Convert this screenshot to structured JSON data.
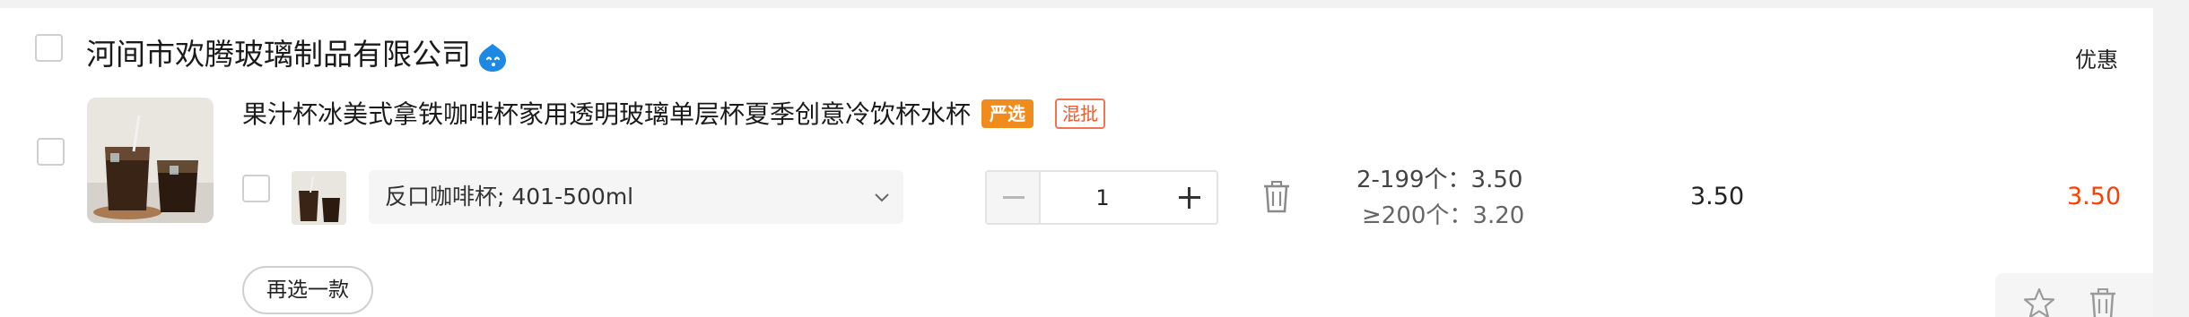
{
  "shop": {
    "name": "河间市欢腾玻璃制品有限公司",
    "icons": {
      "chat": "wangwang-chat-icon"
    }
  },
  "header": {
    "discount_label": "优惠"
  },
  "product": {
    "title": "果汁杯冰美式拿铁咖啡杯家用透明玻璃单层杯夏季创意冷饮杯水杯",
    "tags": [
      "严选",
      "混批"
    ],
    "sku": {
      "selected": "反口咖啡杯; 401-500ml"
    },
    "quantity": "1",
    "price_tiers": [
      "2-199个：3.50",
      "≥200个：3.20"
    ],
    "unit_price": "3.50",
    "total": "3.50"
  },
  "actions": {
    "reselect_label": "再选一款"
  },
  "colors": {
    "accent": "#ff3d00",
    "tag_orange": "#f08c1e",
    "tag_red": "#f05a2c",
    "icon_blue": "#1e88e5"
  }
}
